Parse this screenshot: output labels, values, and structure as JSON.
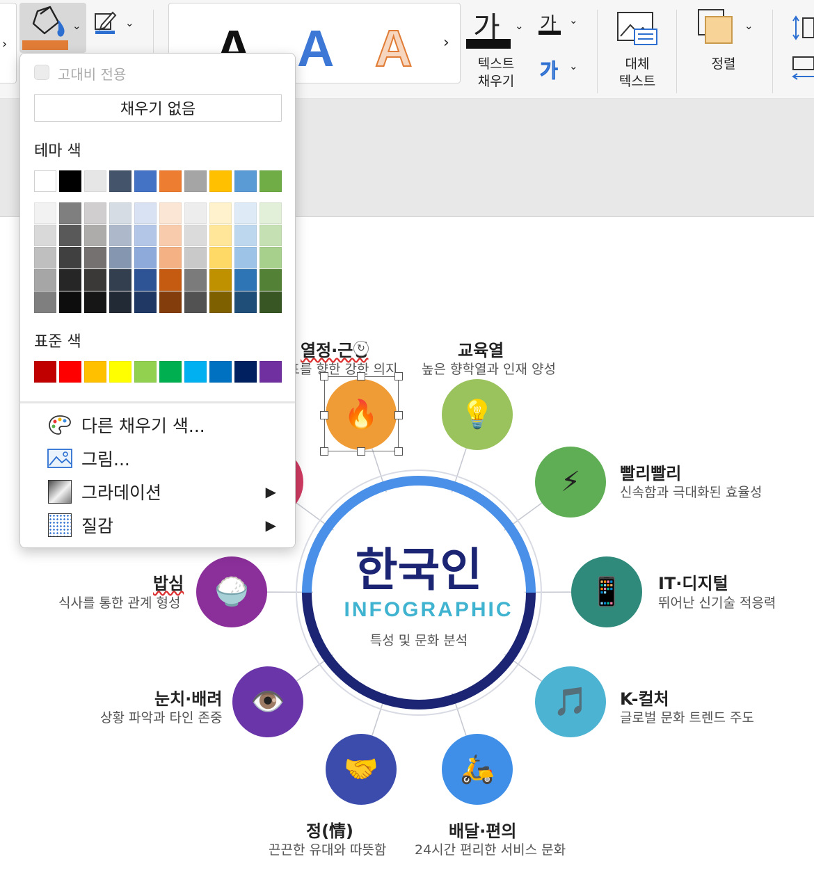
{
  "ribbon": {
    "wordart_letter": "A",
    "text_fill_glyph": "가",
    "text_fill_label": "텍스트\n채우기",
    "text_outline_glyph": "가",
    "text_effect_glyph": "가",
    "alt_text_label": "대체\n텍스트",
    "arrange_label": "정렬",
    "fill_color": "#e07c36"
  },
  "menu": {
    "high_contrast_label": "고대비 전용",
    "no_fill_label": "채우기 없음",
    "theme_colors_title": "테마 색",
    "standard_colors_title": "표준 색",
    "theme_top_row": [
      "#ffffff",
      "#000000",
      "#e7e6e6",
      "#44546a",
      "#4472c4",
      "#ed7d31",
      "#a5a5a5",
      "#ffc000",
      "#5b9bd5",
      "#70ad47"
    ],
    "theme_shades": [
      [
        "#f2f2f2",
        "#d9d9d9",
        "#bfbfbf",
        "#a6a6a6",
        "#7f7f7f"
      ],
      [
        "#7f7f7f",
        "#595959",
        "#404040",
        "#262626",
        "#0d0d0d"
      ],
      [
        "#d0cece",
        "#aeabab",
        "#757171",
        "#3b3838",
        "#171616"
      ],
      [
        "#d6dce4",
        "#adb9ca",
        "#8496b0",
        "#333f4f",
        "#222a35"
      ],
      [
        "#d9e2f3",
        "#b4c6e7",
        "#8eaadb",
        "#2f5496",
        "#1f3864"
      ],
      [
        "#fbe5d5",
        "#f7cbac",
        "#f4b183",
        "#c55a11",
        "#833c0b"
      ],
      [
        "#ededed",
        "#dbdbdb",
        "#c9c9c9",
        "#7b7b7b",
        "#525252"
      ],
      [
        "#fff2cc",
        "#ffe699",
        "#ffd966",
        "#bf9000",
        "#7f6000"
      ],
      [
        "#deebf6",
        "#bdd7ee",
        "#9dc3e6",
        "#2e75b5",
        "#1f4e79"
      ],
      [
        "#e2efd9",
        "#c5e0b3",
        "#a8d08d",
        "#538135",
        "#375623"
      ]
    ],
    "standard_colors": [
      "#c00000",
      "#ff0000",
      "#ffc000",
      "#ffff00",
      "#92d050",
      "#00b050",
      "#00b0f0",
      "#0070c0",
      "#002060",
      "#7030a0"
    ],
    "more_colors_label": "다른 채우기 색...",
    "picture_label": "그림...",
    "gradient_label": "그라데이션",
    "texture_label": "질감",
    "submenu_arrow": "▶"
  },
  "slide": {
    "center_title": "한국인",
    "center_subtitle": "INFOGRAPHIC",
    "center_caption": "특성 및 문화 분석",
    "nodes": [
      {
        "title": "열정·근성",
        "subtitle": "목표를 향한 강한 의지",
        "icon": "🔥",
        "color": "#f09c36"
      },
      {
        "title": "교육열",
        "subtitle": "높은 향학열과 인재 양성",
        "icon": "💡",
        "color": "#9ac35d"
      },
      {
        "title": "빨리빨리",
        "subtitle": "신속함과 극대화된 효율성",
        "icon": "⚡",
        "color": "#5fae55"
      },
      {
        "title": "IT·디지털",
        "subtitle": "뛰어난 신기술 적응력",
        "icon": "📱",
        "color": "#2f8a7c"
      },
      {
        "title": "K-컬처",
        "subtitle": "글로벌 문화 트렌드 주도",
        "icon": "🎵",
        "color": "#4db3d2"
      },
      {
        "title": "배달·편의",
        "subtitle": "24시간 편리한 서비스 문화",
        "icon": "🛵",
        "color": "#3f8fe8"
      },
      {
        "title": "정(情)",
        "subtitle": "끈끈한 유대와 따뜻함",
        "icon": "🤝",
        "color": "#3b4cad"
      },
      {
        "title": "눈치·배려",
        "subtitle": "상황 파악과 타인 존중",
        "icon": "👁️",
        "color": "#6a35a8"
      },
      {
        "title": "밥심",
        "subtitle": "식사를 통한 관계 형성",
        "icon": "🍚",
        "color": "#8b2f9a"
      },
      {
        "title": "",
        "subtitle": "",
        "icon": "",
        "color": "#d13b63"
      }
    ]
  }
}
